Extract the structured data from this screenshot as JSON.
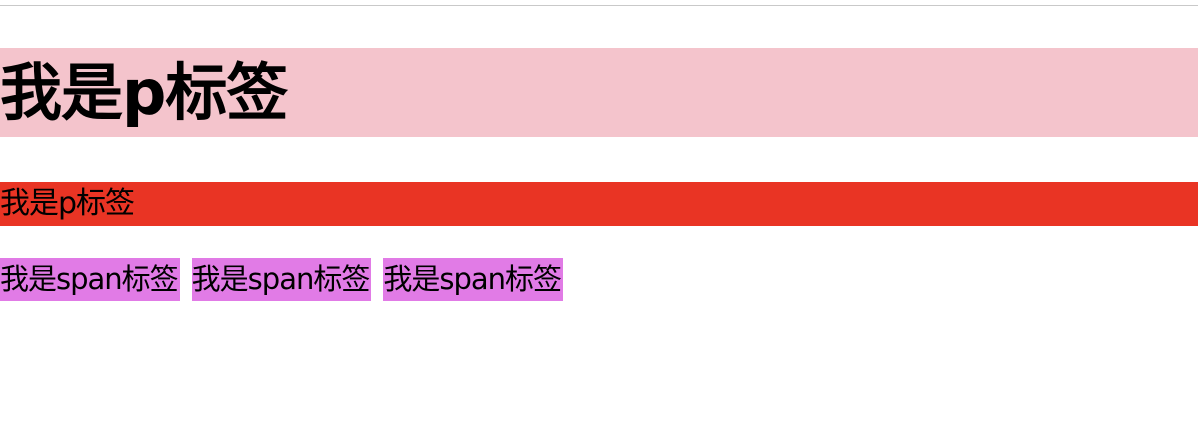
{
  "heading_text": "我是p标签",
  "paragraph_text": "我是p标签",
  "spans": [
    {
      "text": "我是span标签"
    },
    {
      "text": "我是span标签"
    },
    {
      "text": "我是span标签"
    }
  ],
  "colors": {
    "heading_bg": "#f4c4cc",
    "paragraph_bg": "#e93424",
    "span_bg": "#e17be6"
  }
}
